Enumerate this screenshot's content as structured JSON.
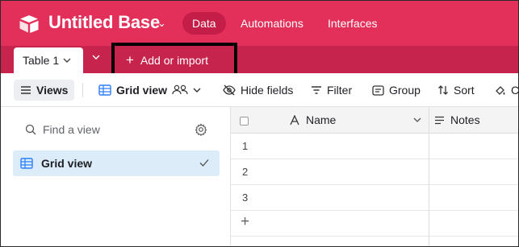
{
  "app": {
    "base_name": "Untitled Base",
    "nav": [
      {
        "label": "Data",
        "active": true
      },
      {
        "label": "Automations",
        "active": false
      },
      {
        "label": "Interfaces",
        "active": false
      }
    ],
    "accent_color": "#e2305a",
    "tabbar_color": "#c7244d"
  },
  "tabs": {
    "active_table": "Table 1",
    "add_import_label": "Add or import"
  },
  "toolbar": {
    "views_label": "Views",
    "grid_view_label": "Grid view",
    "hide_fields_label": "Hide fields",
    "filter_label": "Filter",
    "group_label": "Group",
    "sort_label": "Sort",
    "truncated_label": "Co"
  },
  "sidebar": {
    "search_placeholder": "Find a view",
    "views": [
      {
        "label": "Grid view",
        "selected": true
      }
    ]
  },
  "grid": {
    "columns": [
      {
        "label": "Name",
        "icon": "text-a-icon"
      },
      {
        "label": "Notes",
        "icon": "long-text-icon"
      }
    ],
    "rows": [
      {
        "number": "1",
        "name": "",
        "notes": ""
      },
      {
        "number": "2",
        "name": "",
        "notes": ""
      },
      {
        "number": "3",
        "name": "",
        "notes": ""
      }
    ]
  }
}
